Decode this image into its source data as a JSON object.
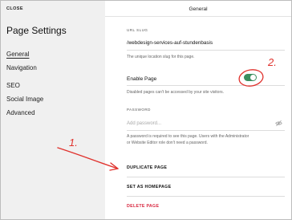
{
  "sidebar": {
    "close_label": "CLOSE",
    "title": "Page Settings",
    "nav": [
      {
        "label": "General",
        "active": true
      },
      {
        "label": "Navigation",
        "active": false
      },
      {
        "label": "SEO",
        "active": false
      },
      {
        "label": "Social Image",
        "active": false
      },
      {
        "label": "Advanced",
        "active": false
      }
    ]
  },
  "main": {
    "header_title": "General",
    "url_slug": {
      "label": "URL SLUG",
      "value": "/webdesign-services-auf-stundenbasis",
      "help": "The unique location slug for this page."
    },
    "enable_page": {
      "label": "Enable Page",
      "enabled": true,
      "help": "Disabled pages can't be accessed by your site visitors."
    },
    "password": {
      "label": "PASSWORD",
      "placeholder": "Add password...",
      "help_line1": "A password is required to see this page. Users with the Administrator",
      "help_line2": "or Website Editor role don't need a password."
    },
    "actions": {
      "duplicate": "DUPLICATE PAGE",
      "set_homepage": "SET AS HOMEPAGE",
      "delete": "DELETE PAGE"
    }
  },
  "annotations": {
    "marker_1": "1.",
    "marker_2": "2.",
    "color": "#e0322d"
  },
  "colors": {
    "toggle_on": "#3a8f5f",
    "danger": "#d8273f",
    "sidebar_bg": "#f0f0f0"
  }
}
